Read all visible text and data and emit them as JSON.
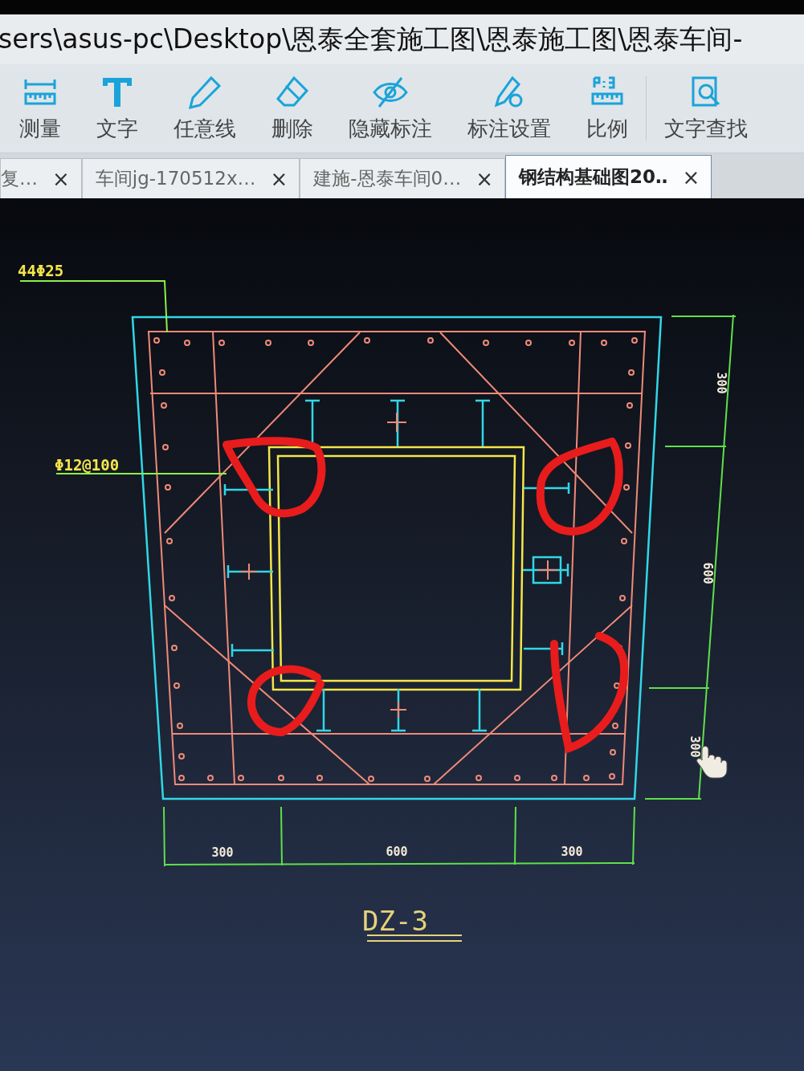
{
  "title_bar": {
    "path": "sers\\asus-pc\\Desktop\\恩泰全套施工图\\恩泰施工图\\恩泰车间-"
  },
  "toolbar": [
    {
      "label": "测量"
    },
    {
      "label": "文字"
    },
    {
      "label": "任意线"
    },
    {
      "label": "删除"
    },
    {
      "label": "隐藏标注"
    },
    {
      "label": "标注设置"
    },
    {
      "label": "比例"
    },
    {
      "label": "文字查找"
    }
  ],
  "tabs": [
    {
      "label": "复…",
      "close": "×",
      "selected": false
    },
    {
      "label": "车间jg-170512x…",
      "close": "×",
      "selected": false
    },
    {
      "label": "建施-恩泰车间0…",
      "close": "×",
      "selected": false
    },
    {
      "label": "钢结构基础图20‥",
      "close": "×",
      "selected": true
    }
  ],
  "drawing": {
    "rebar_label": "44Φ25",
    "stirrup_label": "Φ12@100",
    "right_dimensions": [
      "300",
      "600",
      "300"
    ],
    "bottom_dimensions": [
      "300",
      "600",
      "300"
    ],
    "title": "DZ-3"
  }
}
